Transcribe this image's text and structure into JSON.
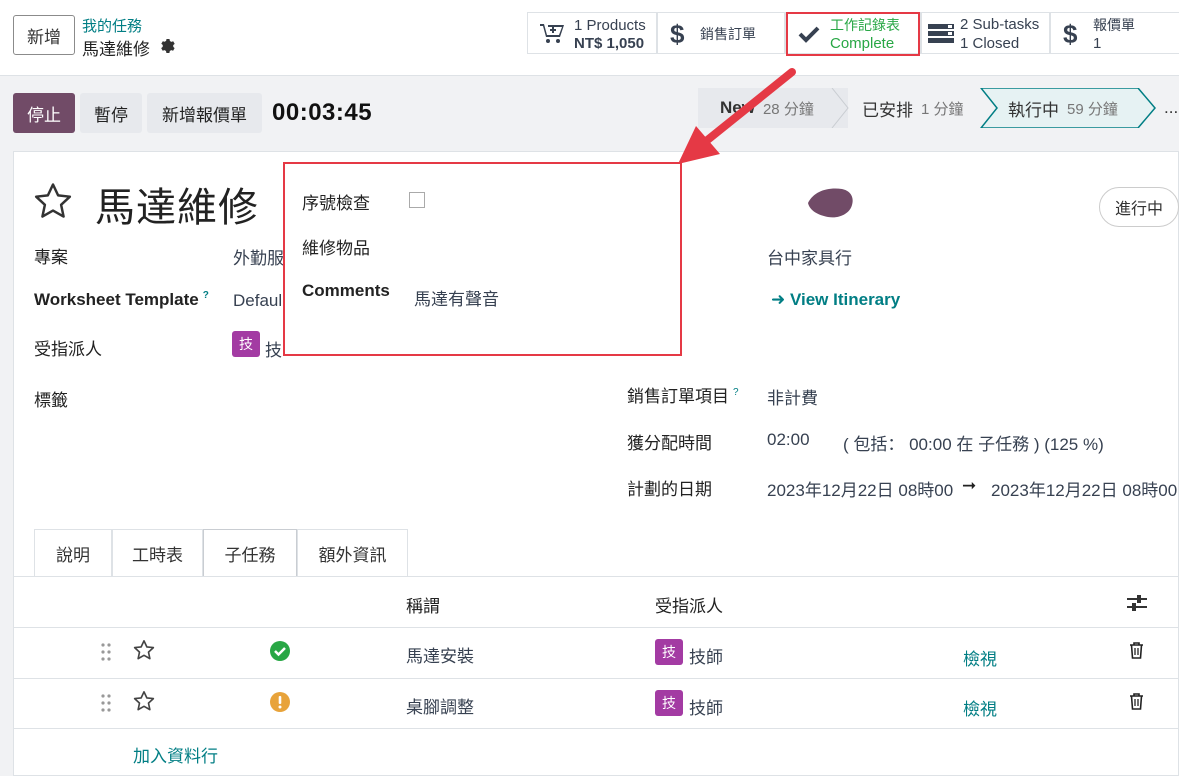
{
  "header": {
    "new_button": "新增",
    "breadcrumb_parent": "我的任務",
    "breadcrumb_current": "馬達維修"
  },
  "smart_buttons": {
    "products_line1": "1 Products",
    "products_line2": "NT$ 1,050",
    "sales_order": "銷售訂單",
    "worksheet_line1": "工作記錄表",
    "worksheet_line2": "Complete",
    "subtasks_line1": "2 Sub-tasks",
    "subtasks_line2": "1 Closed",
    "quotation_line1": "報價單",
    "quotation_line2": "1"
  },
  "controls": {
    "stop": "停止",
    "pause": "暫停",
    "new_quotation": "新增報價單",
    "timer": "00:03:45"
  },
  "stages": [
    {
      "label": "New",
      "count": "28 分鐘"
    },
    {
      "label": "已安排",
      "count": "1 分鐘"
    },
    {
      "label": "執行中",
      "count": "59 分鐘"
    },
    {
      "label": "..."
    }
  ],
  "form": {
    "title": "馬達維修",
    "status": "進行中",
    "project_label": "專案",
    "project_value": "外勤服",
    "worksheet_template_label": "Worksheet Template",
    "worksheet_template_help": "?",
    "worksheet_template_value": "Defaul",
    "assignee_label": "受指派人",
    "assignee_avatar": "技",
    "assignee_value": "技",
    "tags_label": "標籤",
    "customer_value": "台中家具行",
    "view_itinerary": "View Itinerary",
    "sales_order_item_label": "銷售訂單項目",
    "sales_order_item_help": "?",
    "sales_order_item_value": "非計費",
    "allocated_time_label": "獲分配時間",
    "allocated_time_value": "02:00",
    "allocated_time_detail": "( 包括： 00:00 在 子任務 ) (125 %)",
    "planned_date_label": "計劃的日期",
    "planned_date_start": "2023年12月22日 08時00",
    "planned_date_end": "2023年12月22日 08時00"
  },
  "popup": {
    "serial_check_label": "序號檢查",
    "repair_item_label": "維修物品",
    "comments_label": "Comments",
    "comments_value": "馬達有聲音"
  },
  "tabs": [
    "說明",
    "工時表",
    "子任務",
    "額外資訊"
  ],
  "subtasks": {
    "col_name": "稱謂",
    "col_assignee": "受指派人",
    "rows": [
      {
        "name": "馬達安裝",
        "avatar": "技",
        "assignee": "技師",
        "view": "檢視",
        "status": "done"
      },
      {
        "name": "桌腳調整",
        "avatar": "技",
        "assignee": "技師",
        "view": "檢視",
        "status": "warning"
      }
    ],
    "add_line": "加入資料行"
  },
  "colors": {
    "primary": "#714b67",
    "accent": "#017e84",
    "highlight": "#e53945",
    "avatar": "#a33ba3"
  }
}
